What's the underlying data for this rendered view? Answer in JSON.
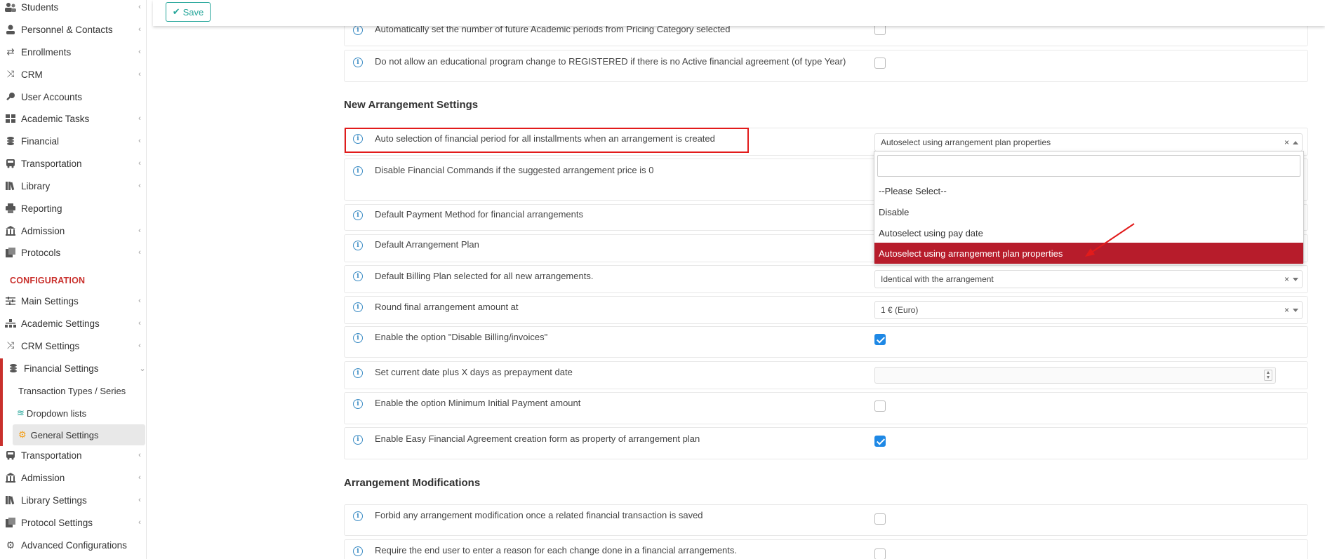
{
  "toolbar": {
    "save_label": "Save"
  },
  "sidebar": {
    "items": [
      {
        "label": "Students",
        "icon": "students-icon",
        "chev": true
      },
      {
        "label": "Personnel & Contacts",
        "icon": "personnel-icon",
        "chev": true
      },
      {
        "label": "Enrollments",
        "icon": "enrollments-icon",
        "chev": true
      },
      {
        "label": "CRM",
        "icon": "crm-icon",
        "chev": true
      },
      {
        "label": "User Accounts",
        "icon": "key-icon",
        "chev": false
      },
      {
        "label": "Academic Tasks",
        "icon": "grid-icon",
        "chev": true
      },
      {
        "label": "Financial",
        "icon": "coins-icon",
        "chev": true
      },
      {
        "label": "Transportation",
        "icon": "bus-icon",
        "chev": true
      },
      {
        "label": "Library",
        "icon": "books-icon",
        "chev": true
      },
      {
        "label": "Reporting",
        "icon": "printer-icon",
        "chev": false
      },
      {
        "label": "Admission",
        "icon": "building-icon",
        "chev": true
      },
      {
        "label": "Protocols",
        "icon": "protocol-icon",
        "chev": true
      }
    ],
    "config_label": "CONFIGURATION",
    "config_items": [
      {
        "label": "Main Settings",
        "icon": "sliders-icon",
        "chev": true
      },
      {
        "label": "Academic Settings",
        "icon": "hierarchy-icon",
        "chev": true
      },
      {
        "label": "CRM Settings",
        "icon": "crm-icon",
        "chev": true
      },
      {
        "label": "Financial Settings",
        "icon": "coins-icon",
        "chev": true
      }
    ],
    "financial_sub": [
      {
        "label": "Transaction Types / Series"
      },
      {
        "label": "Dropdown lists"
      },
      {
        "label": "General Settings"
      }
    ],
    "config_items_after": [
      {
        "label": "Transportation",
        "icon": "bus-icon"
      },
      {
        "label": "Admission",
        "icon": "building-icon"
      },
      {
        "label": "Library Settings",
        "icon": "books-icon"
      },
      {
        "label": "Protocol Settings",
        "icon": "protocol-icon"
      },
      {
        "label": "Advanced Configurations",
        "icon": "gears-icon"
      }
    ]
  },
  "main": {
    "top_rows": [
      {
        "text": "Automatically set the number of future Academic periods from Pricing Category selected"
      },
      {
        "text": "Do not allow an educational program change to REGISTERED if there is no Active financial agreement (of type Year)"
      }
    ],
    "new_arrangement_heading": "New Arrangement Settings",
    "settings": [
      {
        "text": "Auto selection of financial period for all installments when an arrangement is created",
        "value": "Autoselect using arrangement plan properties"
      },
      {
        "text": "Disable Financial Commands if the suggested arrangement price is 0"
      },
      {
        "text": "Default Payment Method for financial arrangements"
      },
      {
        "text": "Default Arrangement Plan"
      },
      {
        "text": "Default Billing Plan selected for all new arrangements.",
        "value": "Identical with the arrangement"
      },
      {
        "text": "Round final arrangement amount at",
        "value": "1 € (Euro)"
      },
      {
        "text": "Enable the option \"Disable Billing/invoices\"",
        "checked": true
      },
      {
        "text": "Set current date plus X days as prepayment date"
      },
      {
        "text": "Enable the option Minimum Initial Payment amount",
        "checked": false
      },
      {
        "text": "Enable Easy Financial Agreement creation form as property of arrangement plan",
        "checked": true
      }
    ],
    "modifications_heading": "Arrangement Modifications",
    "modifications": [
      {
        "text": "Forbid any arrangement modification once a related financial transaction is saved",
        "checked": false
      },
      {
        "text": "Require the end user to enter a reason for each change done in a financial arrangements.",
        "checked": false
      }
    ]
  },
  "dropdown": {
    "options": [
      "--Please Select--",
      "Disable",
      "Autoselect using pay date",
      "Autoselect using arrangement plan properties"
    ],
    "selected_index": 3
  },
  "colors": {
    "accent": "#c9302c",
    "save": "#26a69a",
    "selected_option": "#b71c2b",
    "checkbox": "#1e88e5",
    "highlight": "#e21b1b"
  }
}
